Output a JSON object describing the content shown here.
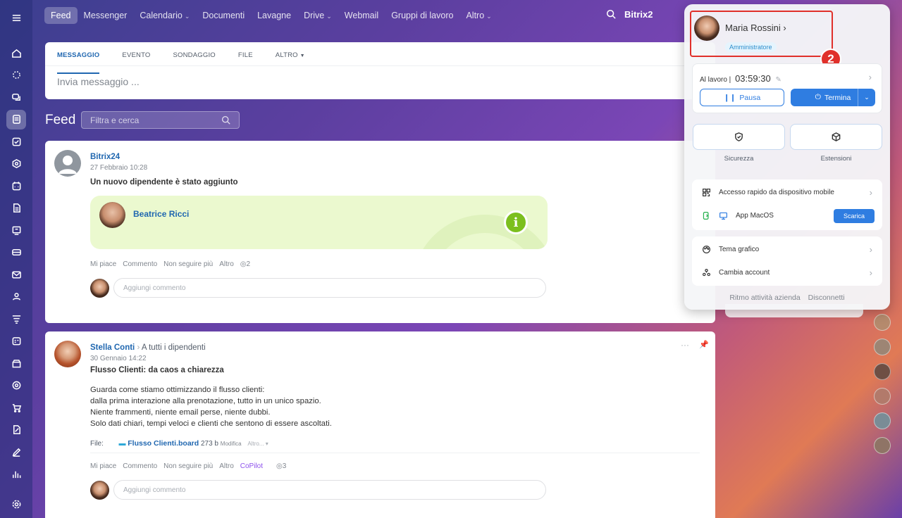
{
  "topnav": {
    "tabs": [
      {
        "label": "Feed",
        "active": true,
        "dropdown": false
      },
      {
        "label": "Messenger",
        "dropdown": false
      },
      {
        "label": "Calendario",
        "dropdown": true
      },
      {
        "label": "Documenti",
        "dropdown": false
      },
      {
        "label": "Lavagne",
        "dropdown": false
      },
      {
        "label": "Drive",
        "dropdown": true
      },
      {
        "label": "Webmail",
        "dropdown": false
      },
      {
        "label": "Gruppi di lavoro",
        "dropdown": false
      },
      {
        "label": "Altro",
        "dropdown": true
      }
    ],
    "brand": "Bitrix2"
  },
  "composer": {
    "tabs": [
      "MESSAGGIO",
      "EVENTO",
      "SONDAGGIO",
      "FILE",
      "ALTRO"
    ],
    "placeholder": "Invia messaggio ..."
  },
  "feed": {
    "title": "Feed",
    "filter_placeholder": "Filtra e cerca"
  },
  "post1": {
    "author": "Bitrix24",
    "date": "27 Febbraio 10:28",
    "title": "Un nuovo dipendente è stato aggiunto",
    "employee": "Beatrice Ricci",
    "actions": [
      "Mi piace",
      "Commento",
      "Non seguire più",
      "Altro"
    ],
    "views": "2",
    "comment_placeholder": "Aggiungi commento"
  },
  "post2": {
    "author": "Stella Conti",
    "recipients": "A tutti i dipendenti",
    "date": "30 Gennaio 14:22",
    "title": "Flusso Clienti: da caos a chiarezza",
    "body": [
      "Guarda come stiamo ottimizzando il flusso clienti:",
      "dalla prima interazione alla prenotazione, tutto in un unico spazio.",
      "Niente frammenti, niente email perse, niente dubbi.",
      "Solo dati chiari, tempi veloci e clienti che sentono di essere ascoltati."
    ],
    "file_label": "File:",
    "file_name": "Flusso Clienti.board",
    "file_size": "273 b",
    "file_edit": "Modifica",
    "file_more": "Altro...",
    "actions": [
      "Mi piace",
      "Commento",
      "Non seguire più",
      "Altro"
    ],
    "copilot": "CoPilot",
    "views": "3",
    "comment_placeholder": "Aggiungi commento"
  },
  "panel": {
    "user_name": "Maria Rossini",
    "role": "Amministratore",
    "step_number": "2",
    "work_status": "Al lavoro |",
    "work_time": "03:59:30",
    "pause": "Pausa",
    "stop": "Termina",
    "security": "Sicurezza",
    "extensions": "Estensioni",
    "mobile_access": "Accesso rapido da dispositivo mobile",
    "macos_app": "App MacOS",
    "download": "Scarica",
    "theme": "Tema grafico",
    "switch_account": "Cambia account",
    "footer_rhythm": "Ritmo attività azienda",
    "footer_logout": "Disconnetti"
  },
  "colors": {
    "accent": "#2f7de1",
    "highlight": "#e0302a",
    "link": "#2067b0"
  }
}
